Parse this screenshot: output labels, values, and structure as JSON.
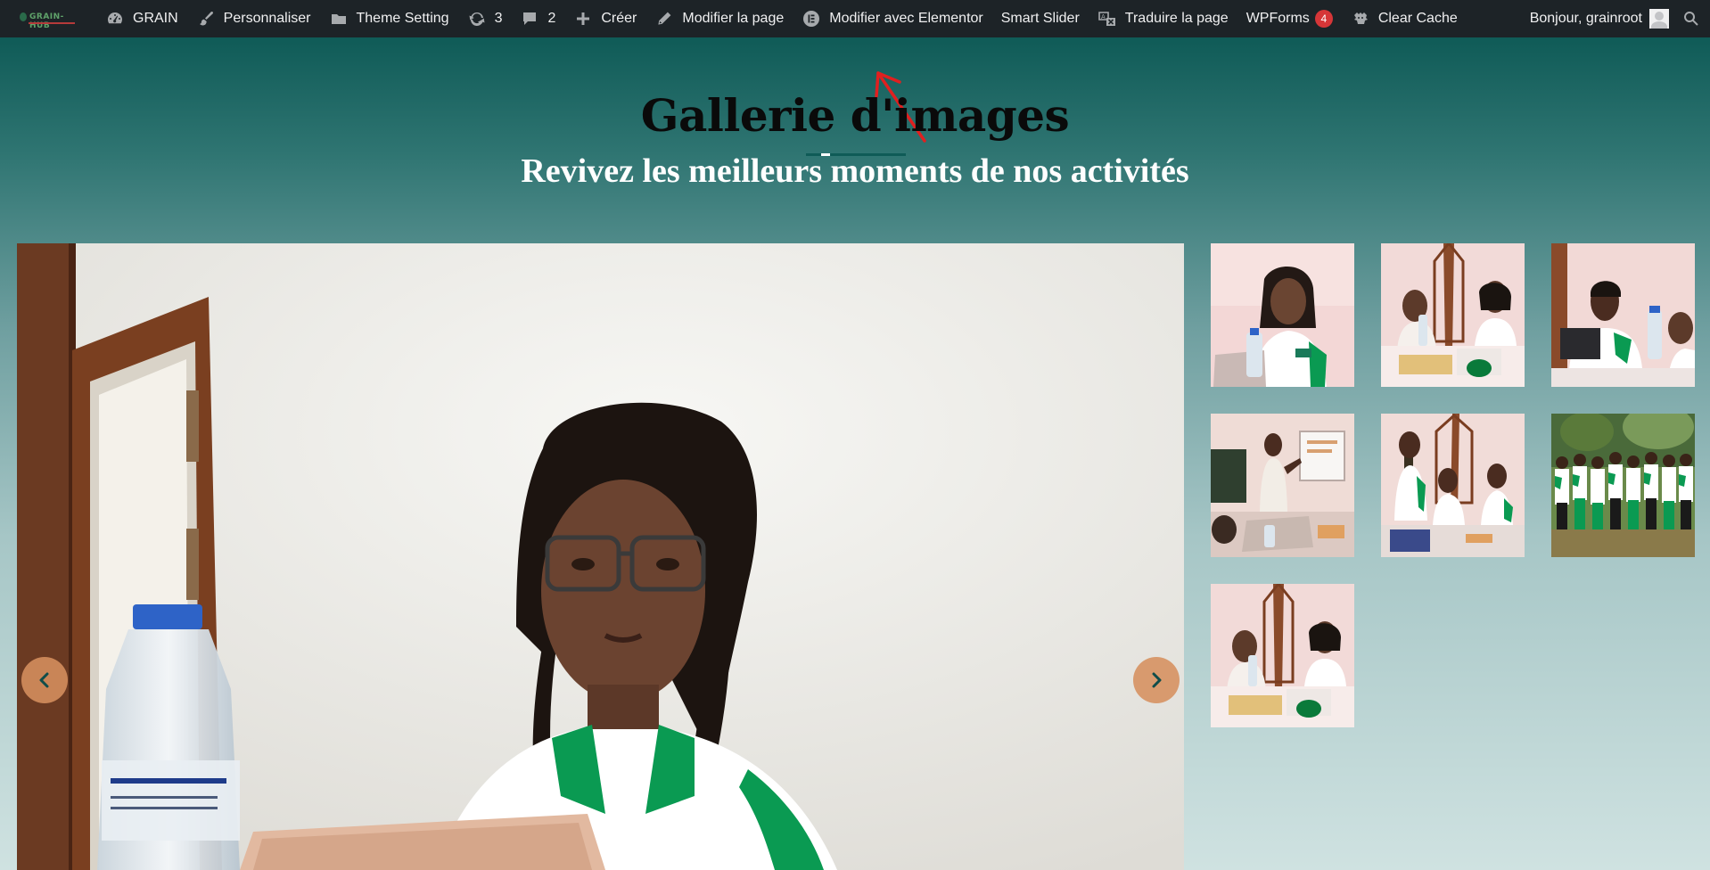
{
  "adminbar": {
    "site_name": "GRAIN",
    "logo_text": "GRAIN-HUB",
    "customize_label": "Personnaliser",
    "theme_setting_label": "Theme Setting",
    "updates_count": "3",
    "comments_count": "2",
    "new_label": "Créer",
    "edit_page_label": "Modifier la page",
    "elementor_label": "Modifier avec Elementor",
    "smart_slider_label": "Smart Slider",
    "translate_label": "Traduire la page",
    "wpforms_label": "WPForms",
    "wpforms_count": "4",
    "clear_cache_label": "Clear Cache",
    "greeting": "Bonjour, grainroot"
  },
  "gallery": {
    "title": "Gallerie d'images",
    "subtitle": "Revivez les meilleurs moments de nos activités",
    "thumbnails": [
      {
        "name": "woman-at-laptop"
      },
      {
        "name": "two-women-at-table"
      },
      {
        "name": "man-at-laptop"
      },
      {
        "name": "presenter-in-classroom"
      },
      {
        "name": "group-at-table"
      },
      {
        "name": "group-photo-outdoors"
      },
      {
        "name": "two-women-at-table-repeat"
      }
    ]
  },
  "colors": {
    "adminbar_bg": "#1d2327",
    "accent_teal": "#0f5b57",
    "nav_button": "#d68f5f",
    "badge_red": "#d63638"
  },
  "icons": [
    "dashboard-icon",
    "brush-icon",
    "folder-icon",
    "updates-icon",
    "comment-icon",
    "plus-icon",
    "pencil-icon",
    "elementor-icon",
    "translate-icon",
    "cache-icon",
    "search-icon",
    "chevron-left-icon",
    "chevron-right-icon"
  ]
}
